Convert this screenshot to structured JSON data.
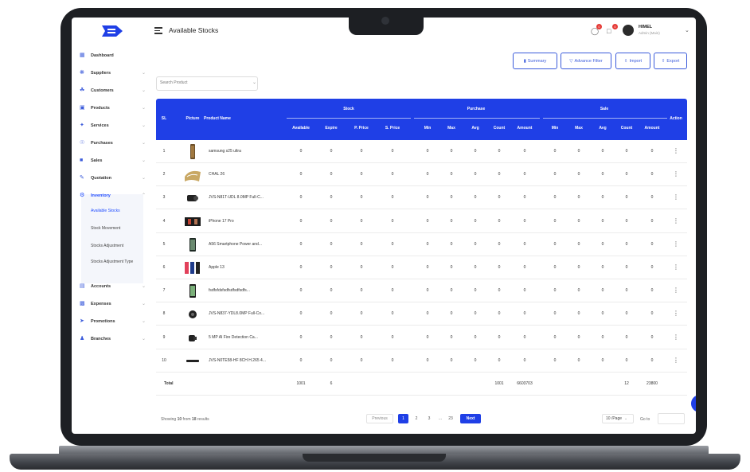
{
  "header": {
    "page_title": "Available Stocks",
    "user_name": "HIMEL",
    "user_role": "Admin (Main)"
  },
  "sidebar": {
    "items": [
      {
        "label": "Dashboard",
        "icon": "grid-icon"
      },
      {
        "label": "Suppliers",
        "icon": "suppliers-icon"
      },
      {
        "label": "Customers",
        "icon": "customers-icon"
      },
      {
        "label": "Products",
        "icon": "box-icon"
      },
      {
        "label": "Services",
        "icon": "wrench-icon"
      },
      {
        "label": "Purchases",
        "icon": "cart-icon"
      },
      {
        "label": "Sales",
        "icon": "bag-icon"
      },
      {
        "label": "Quotation",
        "icon": "quote-icon"
      },
      {
        "label": "Inventory",
        "icon": "inventory-icon"
      },
      {
        "label": "Accounts",
        "icon": "accounts-icon"
      },
      {
        "label": "Expenses",
        "icon": "expenses-icon"
      },
      {
        "label": "Promotions",
        "icon": "megaphone-icon"
      },
      {
        "label": "Branches",
        "icon": "branches-icon"
      }
    ],
    "inventory_sub": [
      "Available Stocks",
      "Stock Movement",
      "Stocks Adjustment",
      "Stocks Adjustment Type"
    ]
  },
  "actions": {
    "summary": "Summary",
    "advance_filter": "Advance Filter",
    "import": "Import",
    "export": "Export"
  },
  "search": {
    "placeholder": "Search Product"
  },
  "table": {
    "headers": {
      "sl": "SL",
      "picture": "Picture",
      "product_name": "Product Name",
      "stock": "Stock",
      "purchase": "Purchase",
      "sale": "Sale",
      "action": "Action",
      "available": "Available",
      "expire": "Expire",
      "p_price": "P. Price",
      "s_price": "S. Price",
      "min": "Min",
      "max": "Max",
      "avg": "Avg",
      "count": "Count",
      "amount": "Amount"
    },
    "rows": [
      {
        "sl": "1",
        "name": "samsung s25 ultra"
      },
      {
        "sl": "2",
        "name": "CHAL 26"
      },
      {
        "sl": "3",
        "name": "JVS-N81T-UDL 8.0MP Full-C..."
      },
      {
        "sl": "4",
        "name": "iPhone 17 Pro"
      },
      {
        "sl": "5",
        "name": "A56 Smartphone Power and..."
      },
      {
        "sl": "6",
        "name": "Apple 13"
      },
      {
        "sl": "7",
        "name": "fsdfsfdsfsdfsdfsdfsdfs..."
      },
      {
        "sl": "8",
        "name": "JVS-N837-YDL8.0MP Full-Co..."
      },
      {
        "sl": "9",
        "name": "5 MP AI Fire Detection Ca..."
      },
      {
        "sl": "10",
        "name": "JVS-N0TE58-HF 8CH H.265 4..."
      }
    ],
    "zero": "0",
    "action_glyph": "⋮",
    "total": {
      "label": "Total",
      "available": "1001",
      "expire": "6",
      "purchase_count": "1001",
      "purchase_amount": "6603703",
      "sale_count": "12",
      "sale_amount": "23800"
    }
  },
  "pagination": {
    "showing_prefix": "Showing",
    "showing_from_to": "10",
    "showing_mid": "from",
    "showing_total": "18",
    "showing_suffix": "results",
    "previous": "Previous",
    "pages": [
      "1",
      "2",
      "3",
      "...",
      "23"
    ],
    "next": "Next",
    "per_page": "10 /Page",
    "goto": "Go to"
  },
  "notifications": {
    "count_a": "0",
    "count_b": "0"
  },
  "colors": {
    "primary": "#1f3fe6",
    "accent": "#3b5bdb"
  }
}
